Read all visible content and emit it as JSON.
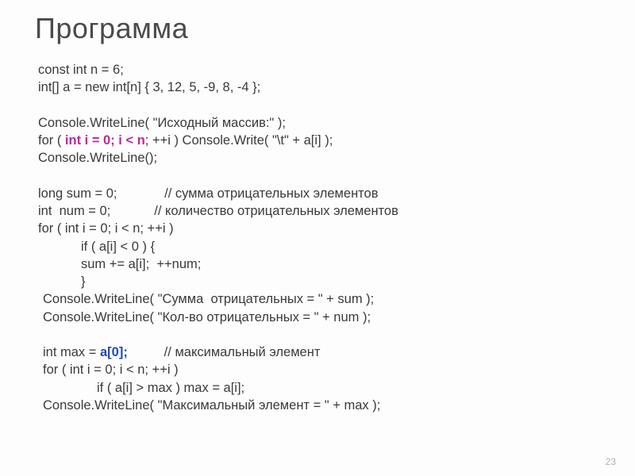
{
  "title": "Программа",
  "code": {
    "l1": "const int n = 6;",
    "l2": "int[] a = new int[n] { 3, 12, 5, -9, 8, -4 };",
    "l3": "Console.WriteLine( \"Исходный массив:\" );",
    "l4a": "for ( ",
    "l4b": "int i = 0; i < n",
    "l4c": "; ++i ) Console.Write( \"\\t\" + a[i] );",
    "l5": "Console.WriteLine();",
    "l6": "long sum = 0;             // сумма отрицательных элементов",
    "l7": "int  num = 0;            // количество отрицательных элементов",
    "l8": "for ( int i = 0; i < n; ++i )",
    "l9": "if ( a[i] < 0 ) {",
    "l10": "sum += a[i];  ++num;",
    "l11": "}",
    "l12": "Console.WriteLine( \"Сумма  отрицательных = \" + sum );",
    "l13": "Console.WriteLine( \"Кол-во отрицательных = \" + num );",
    "l14a": "int max = ",
    "l14b": "a[0];",
    "l14c": "          // максимальный элемент",
    "l15": "for ( int i = 0; i < n; ++i )",
    "l16": "if ( a[i] > max ) max = a[i];",
    "l17": "Console.WriteLine( \"Максимальный элемент = \" + max );"
  },
  "page": "23"
}
